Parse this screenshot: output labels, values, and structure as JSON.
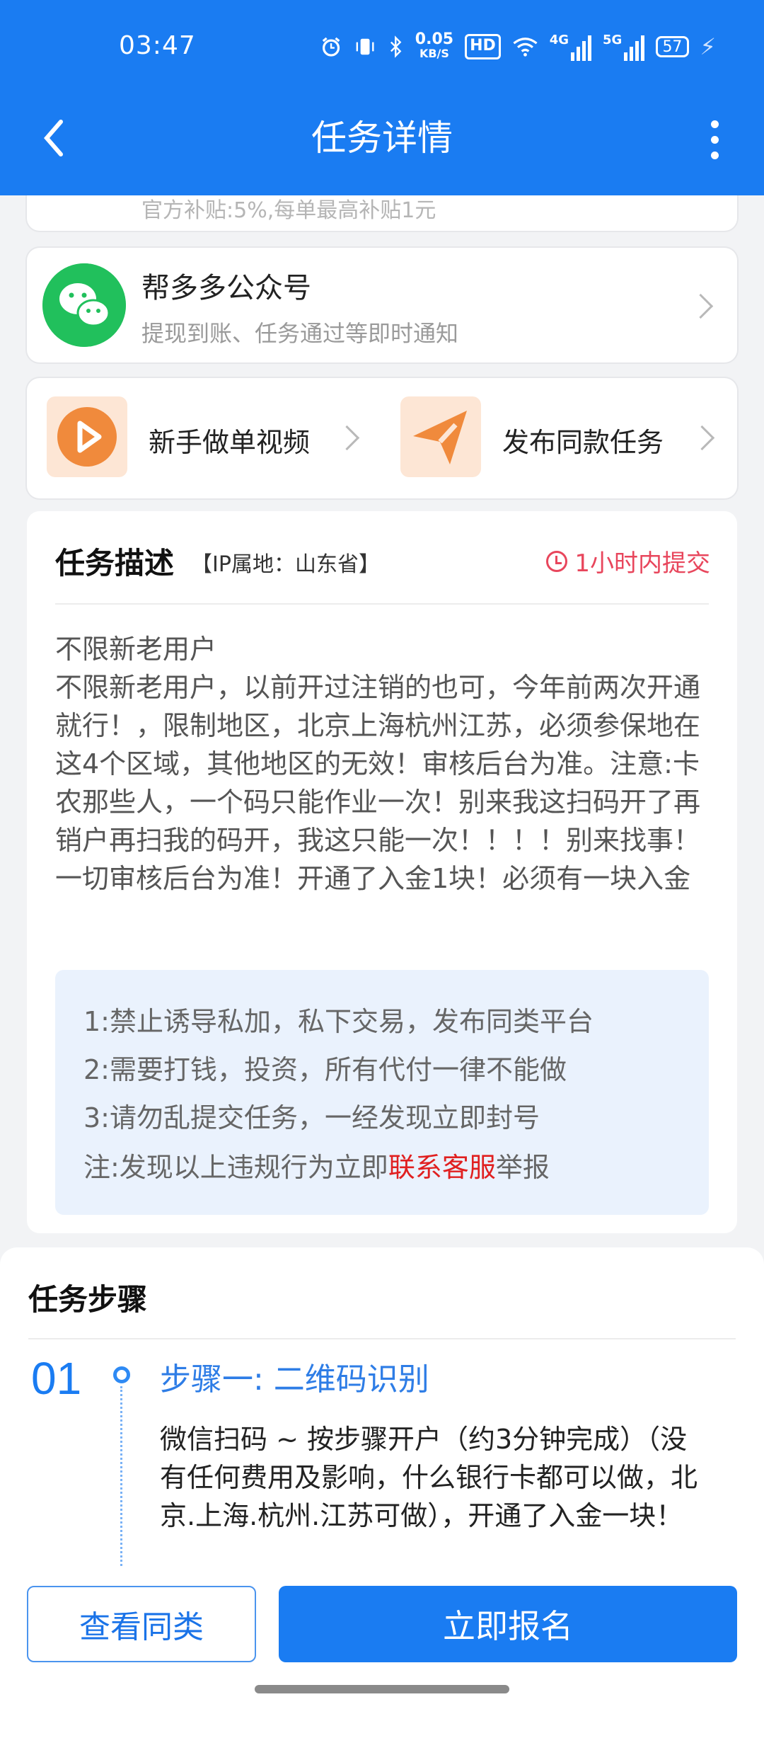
{
  "status": {
    "time": "03:47",
    "net_speed": "0.05",
    "net_unit": "KB/S",
    "hd": "HD",
    "net1": "4G",
    "net2": "5G",
    "battery": "57"
  },
  "header": {
    "title": "任务详情"
  },
  "subsidy": {
    "text": "官方补贴:5%,每单最高补贴1元"
  },
  "wechat": {
    "title": "帮多多公众号",
    "subtitle": "提现到账、任务通过等即时通知"
  },
  "quick": {
    "video_label": "新手做单视频",
    "publish_label": "发布同款任务"
  },
  "description": {
    "title": "任务描述",
    "ip": "【IP属地：山东省】",
    "deadline": "1小时内提交",
    "body": "不限新老用户\n不限新老用户，以前开过注销的也可，今年前两次开通就行！，限制地区，北京上海杭州江苏，必须参保地在这4个区域，其他地区的无效！审核后台为准。注意:卡农那些人，一个码只能作业一次！别来我这扫码开了再销户再扫我的码开，我这只能一次！！！！别来找事！一切审核后台为准！开通了入金1块！必须有一块入金",
    "rules": [
      "1:禁止诱导私加，私下交易，发布同类平台",
      "2:需要打钱，投资，所有代付一律不能做",
      "3:请勿乱提交任务，一经发现立即封号"
    ],
    "note_prefix": "注:发现以上违规行为立即",
    "note_link": "联系客服",
    "note_suffix": "举报"
  },
  "steps": {
    "title": "任务步骤",
    "items": [
      {
        "num": "01",
        "head": "步骤一: 二维码识别",
        "body": "微信扫码 ~ 按步骤开户（约3分钟完成）（没有任何费用及影响，什么银行卡都可以做，北京.上海.杭州.江苏可做），开通了入金一块！"
      }
    ]
  },
  "bottom": {
    "similar_label": "查看同类",
    "apply_label": "立即报名"
  },
  "colors": {
    "primary": "#1a7cf2",
    "danger": "#e8465c",
    "wechat_green": "#21c05c",
    "accent_orange": "#f08a3c"
  }
}
